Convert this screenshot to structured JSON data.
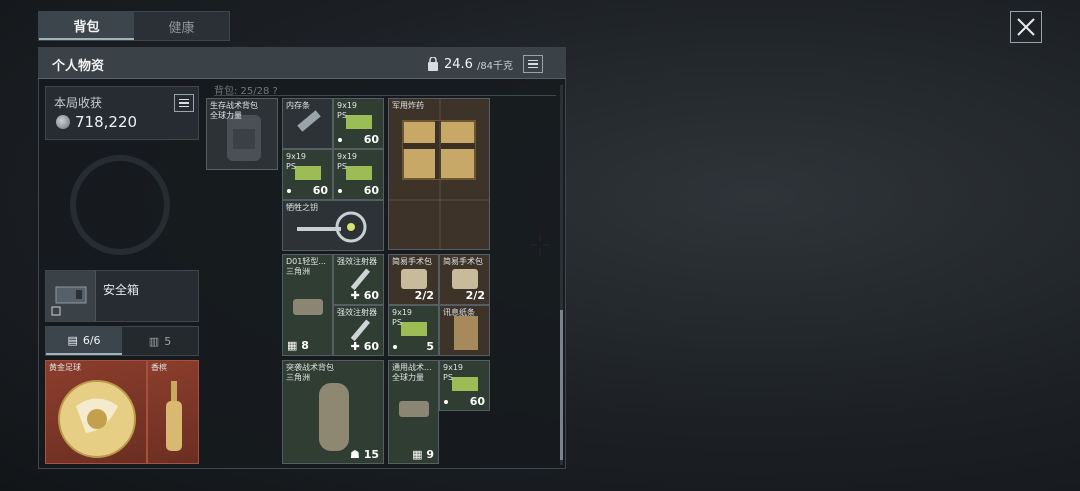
{
  "tabs": [
    {
      "label": "背包",
      "active": true
    },
    {
      "label": "健康",
      "active": false
    }
  ],
  "header": {
    "title": "个人物资",
    "weight_current": "24.6",
    "weight_max": "/84千克"
  },
  "harvest": {
    "label": "本局收获",
    "value": "718,220"
  },
  "capacity_text": "背包: 25/28 ?",
  "safebox": {
    "label": "安全箱"
  },
  "subtabs": [
    {
      "label": "6/6",
      "icon": "briefcase-icon",
      "active": true
    },
    {
      "label": "5",
      "icon": "canister-icon",
      "active": false
    }
  ],
  "left_items": [
    {
      "name": "黄金足球"
    },
    {
      "name": "香槟"
    }
  ],
  "equipped_backpack": {
    "name1": "生存战术背包",
    "name2": "全球力量"
  },
  "items": {
    "memory": {
      "name": "内存条"
    },
    "ammo1": {
      "name1": "9x19",
      "name2": "PS",
      "count": "60"
    },
    "ammo2": {
      "name1": "9x19",
      "name2": "PS",
      "count": "60"
    },
    "ammo3": {
      "name1": "9x19",
      "name2": "PS",
      "count": "60"
    },
    "explosives": {
      "name": "军用炸药"
    },
    "key": {
      "name": "牺牲之钥"
    },
    "bag1": {
      "name1": "D01轻型...",
      "name2": "三角洲",
      "count": "8"
    },
    "injector1": {
      "name": "强效注射器",
      "count": "60"
    },
    "injector2": {
      "name": "强效注射器",
      "count": "60"
    },
    "surgery1": {
      "name": "简易手术包",
      "count": "2/2"
    },
    "surgery2": {
      "name": "简易手术包",
      "count": "2/2"
    },
    "ammo4": {
      "name1": "9x19",
      "name2": "PS",
      "count": "5"
    },
    "note": {
      "name": "讯息纸条"
    },
    "assault_bag": {
      "name1": "突袭战术背包",
      "name2": "三角洲",
      "count": "15"
    },
    "general_bag": {
      "name1": "通用战术...",
      "name2": "全球力量",
      "count": "9"
    },
    "ammo5": {
      "name1": "9x19",
      "name2": "PS",
      "count": "60"
    }
  },
  "colors": {
    "accent": "#9fb3bd",
    "gold_slot": "#8c3e2c",
    "green_slot": "#2f3d33"
  }
}
